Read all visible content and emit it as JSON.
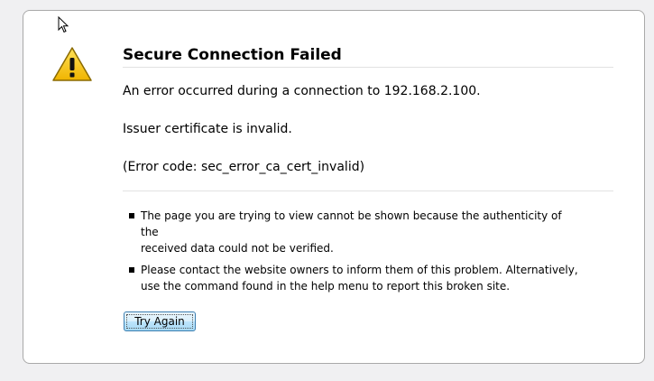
{
  "error": {
    "title": "Secure Connection Failed",
    "message": "An error occurred during a connection to 192.168.2.100.",
    "detail": "Issuer certificate is invalid.",
    "code": "(Error code: sec_error_ca_cert_invalid)"
  },
  "bullets": [
    {
      "line1": "The page you are trying to view cannot be shown because the authenticity of the",
      "line2": "received data could not be verified."
    },
    {
      "line1": "Please contact the website owners to inform them of this problem. Alternatively,",
      "line2": "use the command found in the help menu to report this broken site."
    }
  ],
  "actions": {
    "try_again_label": "Try Again"
  },
  "icons": {
    "warning": "warning-triangle-icon",
    "cursor": "mouse-pointer-icon"
  },
  "colors": {
    "warning_fill": "#f5c400",
    "button_border": "#3c7fb1"
  }
}
